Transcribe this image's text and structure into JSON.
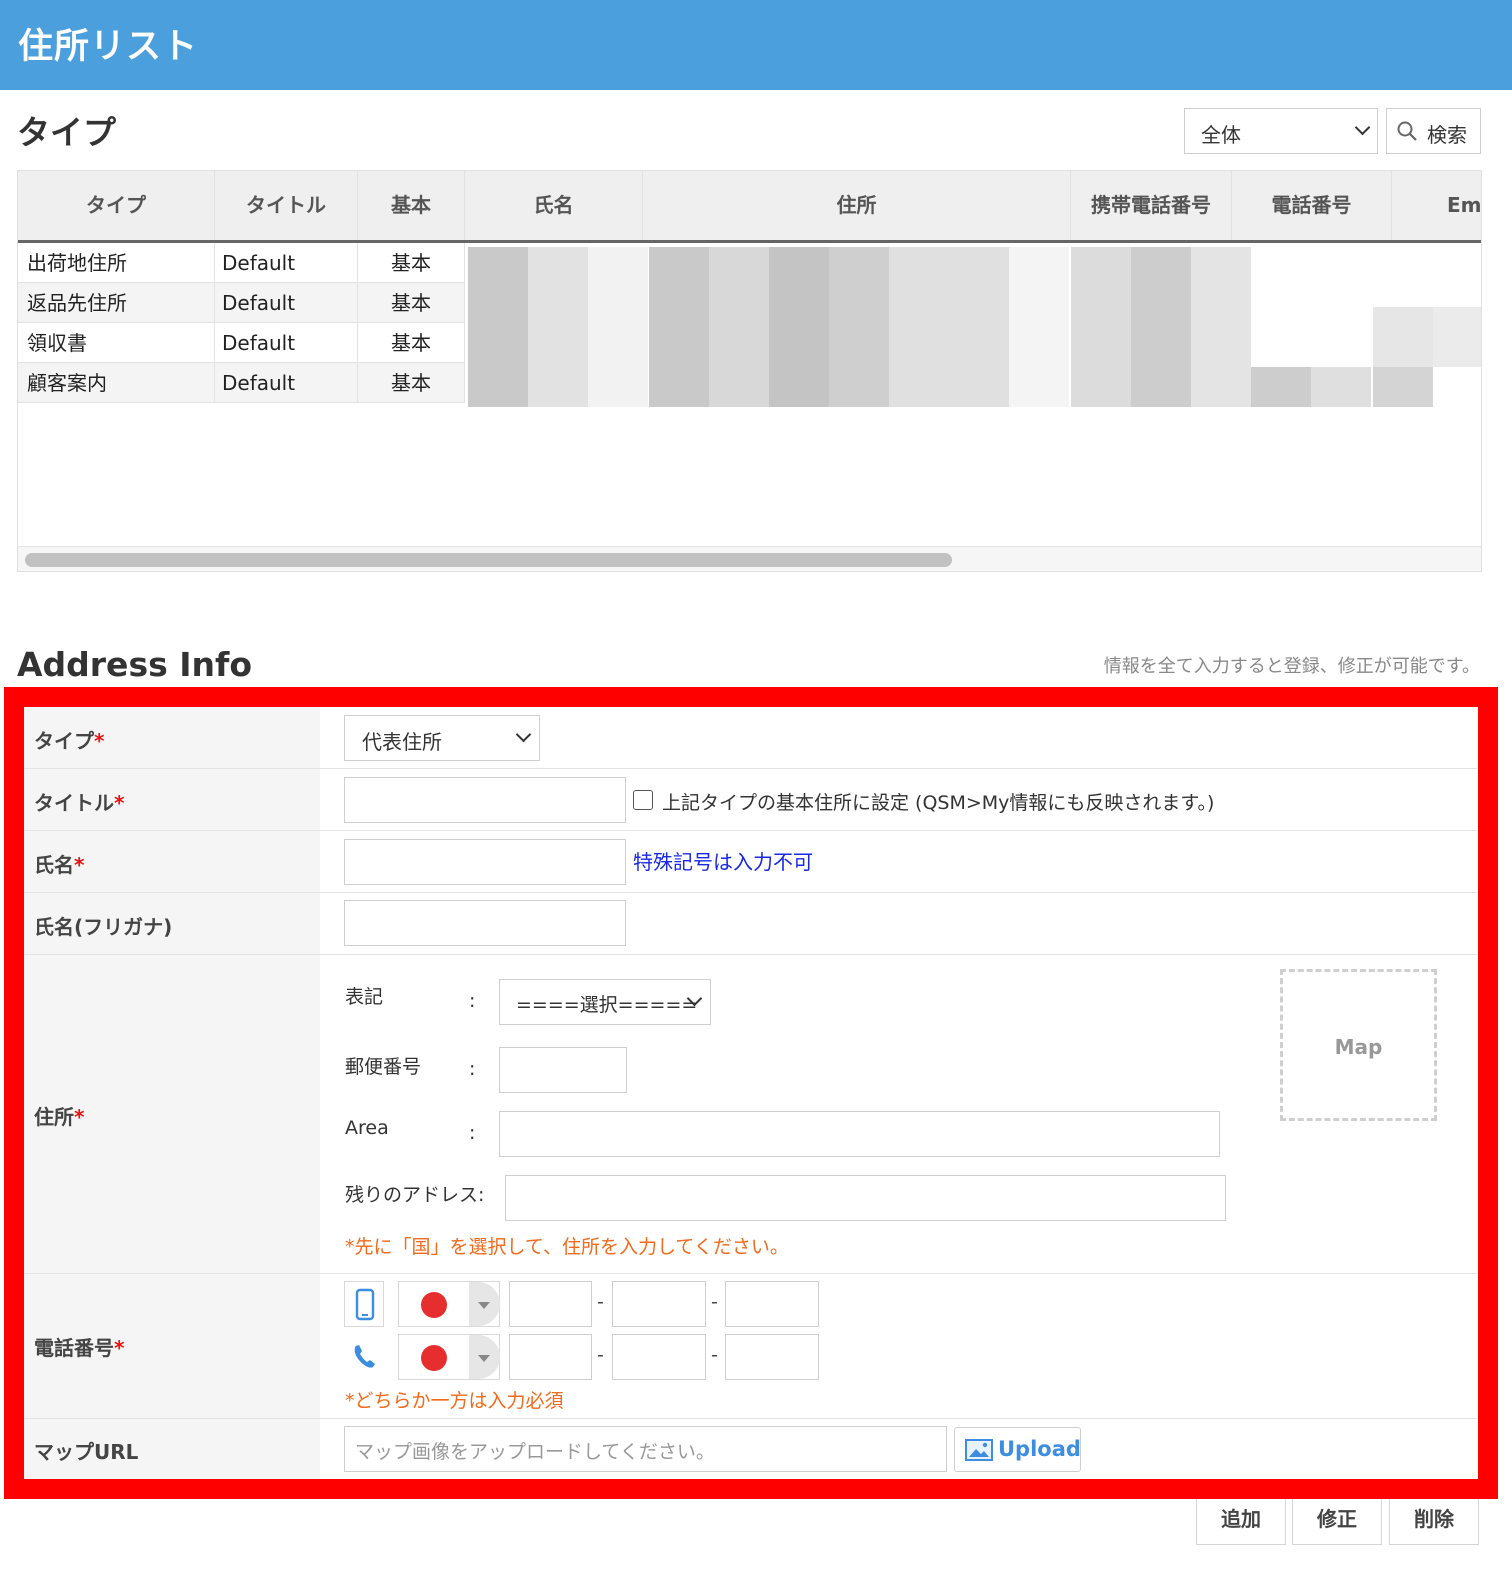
{
  "header": {
    "title": "住所リスト"
  },
  "type_section": {
    "title": "タイプ",
    "filter_select": "全体",
    "search_label": "検索"
  },
  "grid": {
    "columns": [
      "タイプ",
      "タイトル",
      "基本",
      "氏名",
      "住所",
      "携帯電話番号",
      "電話番号",
      "Em"
    ],
    "rows": [
      {
        "type": "出荷地住所",
        "title": "Default",
        "basic": "基本"
      },
      {
        "type": "返品先住所",
        "title": "Default",
        "basic": "基本"
      },
      {
        "type": "領収書",
        "title": "Default",
        "basic": "基本"
      },
      {
        "type": "顧客案内",
        "title": "Default",
        "basic": "基本"
      }
    ]
  },
  "address_info": {
    "title": "Address Info",
    "note": "情報を全て入力すると登録、修正が可能です。",
    "req_mark": "*",
    "fields": {
      "type_label": "タイプ",
      "type_value": "代表住所",
      "title_label": "タイトル",
      "default_checkbox_label": "上記タイプの基本住所に設定 (QSM>My情報にも反映されます。)",
      "name_label": "氏名",
      "name_hint": "特殊記号は入力不可",
      "kana_label": "氏名(フリガナ)",
      "address_label": "住所",
      "notation_label": "表記",
      "notation_value": "====選択=====",
      "zip_label": "郵便番号",
      "area_label": "Area",
      "rest_label": "残りのアドレス",
      "colon": ":",
      "address_note": "*先に「国」を選択して、住所を入力してください。",
      "map_label": "Map",
      "phone_label": "電話番号",
      "phone_sep": "-",
      "phone_note": "*どちらか一方は入力必須",
      "map_url_label": "マップURL",
      "map_url_placeholder": "マップ画像をアップロードしてください。",
      "upload_label": "Upload"
    }
  },
  "actions": {
    "add": "追加",
    "edit": "修正",
    "delete": "削除"
  },
  "colors": {
    "header_bg": "#4a9fdc",
    "highlight_border": "#ff0000",
    "note_orange": "#f26a1b",
    "hint_blue": "#1a28e6",
    "flag_red": "#e62e2e"
  },
  "icons": [
    "search-icon",
    "chevron-down-icon",
    "mobile-phone-icon",
    "telephone-icon",
    "image-icon"
  ]
}
